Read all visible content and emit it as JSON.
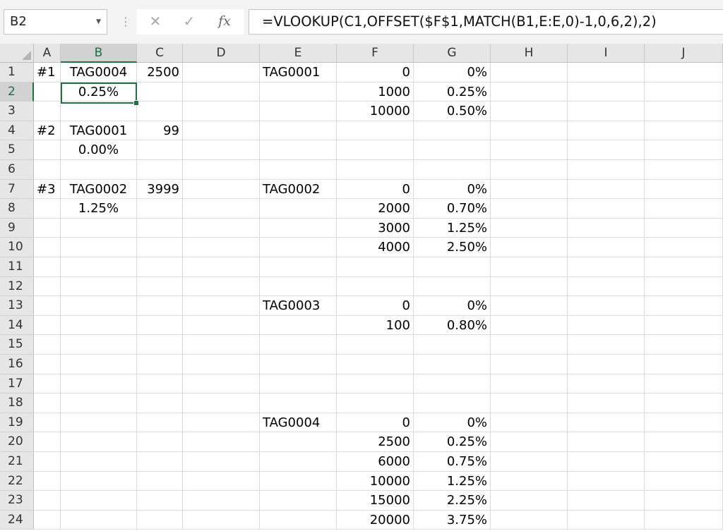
{
  "formula_bar": {
    "name_box": "B2",
    "formula": "=VLOOKUP(C1,OFFSET($F$1,MATCH(B1,E:E,0)-1,0,6,2),2)",
    "icons": [
      "cancel-icon",
      "enter-icon",
      "fx-icon"
    ]
  },
  "selected_cell": "B2",
  "columns": [
    "A",
    "B",
    "C",
    "D",
    "E",
    "F",
    "G",
    "H",
    "I",
    "J"
  ],
  "rows": [
    "1",
    "2",
    "3",
    "4",
    "5",
    "6",
    "7",
    "8",
    "9",
    "10",
    "11",
    "12",
    "13",
    "14",
    "15",
    "16",
    "17",
    "18",
    "19",
    "20",
    "21",
    "22",
    "23",
    "24"
  ],
  "cells": [
    {
      "ref": "A1",
      "value": "#1"
    },
    {
      "ref": "B1",
      "value": "TAG0004"
    },
    {
      "ref": "C1",
      "value": "2500"
    },
    {
      "ref": "B2",
      "value": "0.25%"
    },
    {
      "ref": "A4",
      "value": "#2"
    },
    {
      "ref": "B4",
      "value": "TAG0001"
    },
    {
      "ref": "C4",
      "value": "99"
    },
    {
      "ref": "B5",
      "value": "0.00%"
    },
    {
      "ref": "A7",
      "value": "#3"
    },
    {
      "ref": "B7",
      "value": "TAG0002"
    },
    {
      "ref": "C7",
      "value": "3999"
    },
    {
      "ref": "B8",
      "value": "1.25%"
    },
    {
      "ref": "E1",
      "value": "TAG0001"
    },
    {
      "ref": "F1",
      "value": "0"
    },
    {
      "ref": "G1",
      "value": "0%"
    },
    {
      "ref": "F2",
      "value": "1000"
    },
    {
      "ref": "G2",
      "value": "0.25%"
    },
    {
      "ref": "F3",
      "value": "10000"
    },
    {
      "ref": "G3",
      "value": "0.50%"
    },
    {
      "ref": "E7",
      "value": "TAG0002"
    },
    {
      "ref": "F7",
      "value": "0"
    },
    {
      "ref": "G7",
      "value": "0%"
    },
    {
      "ref": "F8",
      "value": "2000"
    },
    {
      "ref": "G8",
      "value": "0.70%"
    },
    {
      "ref": "F9",
      "value": "3000"
    },
    {
      "ref": "G9",
      "value": "1.25%"
    },
    {
      "ref": "F10",
      "value": "4000"
    },
    {
      "ref": "G10",
      "value": "2.50%"
    },
    {
      "ref": "E13",
      "value": "TAG0003"
    },
    {
      "ref": "F13",
      "value": "0"
    },
    {
      "ref": "G13",
      "value": "0%"
    },
    {
      "ref": "F14",
      "value": "100"
    },
    {
      "ref": "G14",
      "value": "0.80%"
    },
    {
      "ref": "E19",
      "value": "TAG0004"
    },
    {
      "ref": "F19",
      "value": "0"
    },
    {
      "ref": "G19",
      "value": "0%"
    },
    {
      "ref": "F20",
      "value": "2500"
    },
    {
      "ref": "G20",
      "value": "0.25%"
    },
    {
      "ref": "F21",
      "value": "6000"
    },
    {
      "ref": "G21",
      "value": "0.75%"
    },
    {
      "ref": "F22",
      "value": "10000"
    },
    {
      "ref": "G22",
      "value": "1.25%"
    },
    {
      "ref": "F23",
      "value": "15000"
    },
    {
      "ref": "G23",
      "value": "2.25%"
    },
    {
      "ref": "F24",
      "value": "20000"
    },
    {
      "ref": "G24",
      "value": "3.75%"
    }
  ]
}
